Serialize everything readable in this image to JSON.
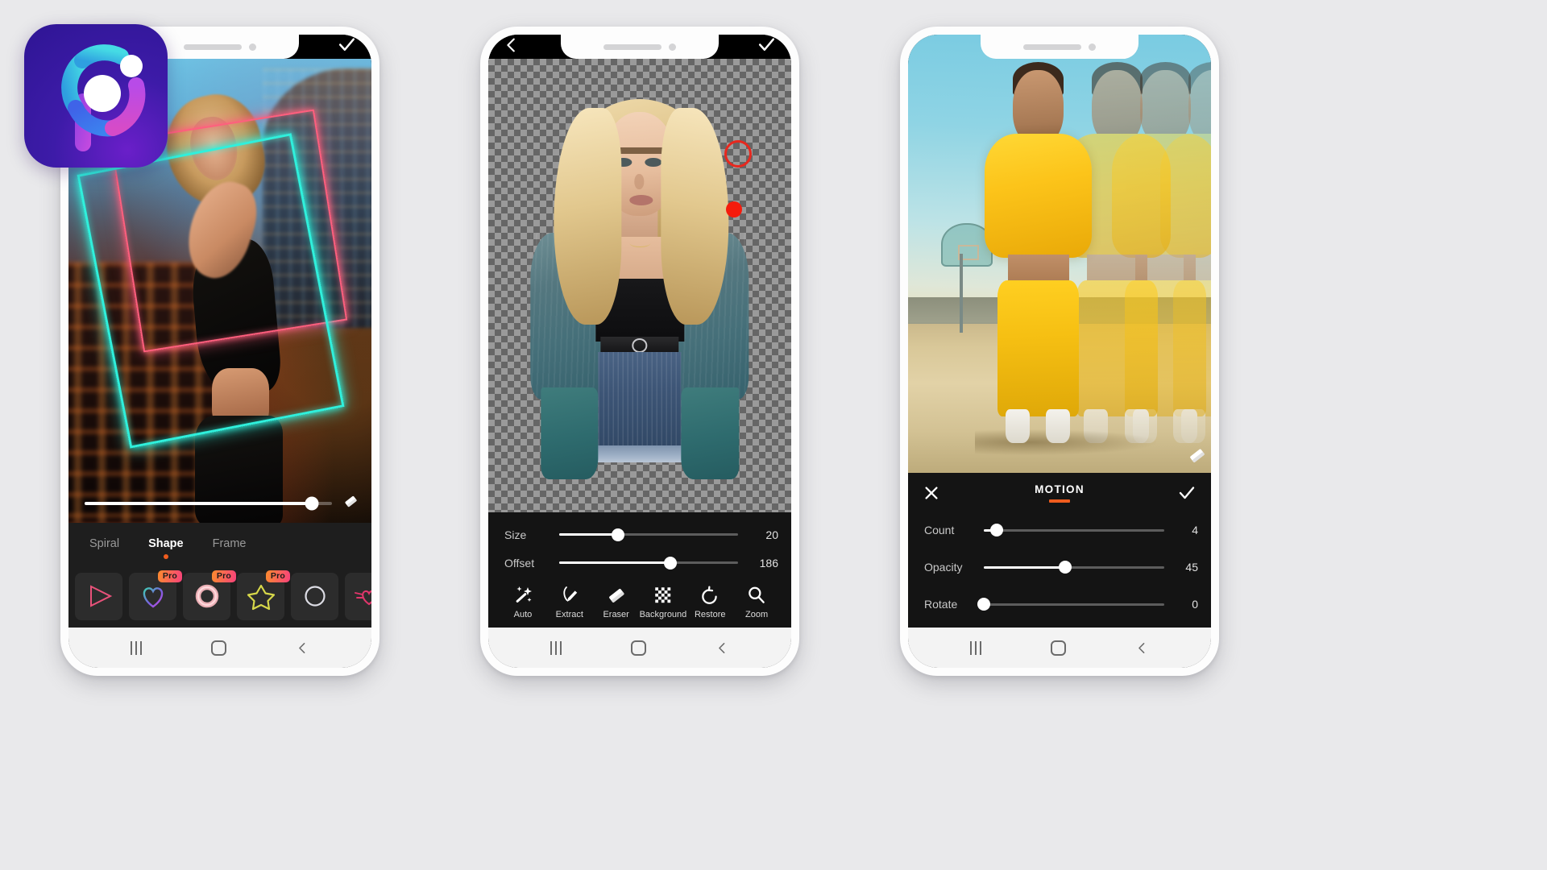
{
  "background_color": "#e9e9eb",
  "app_icon": {
    "name": "picsart-app-icon",
    "colors": {
      "bg_start": "#6a1fc9",
      "bg_end": "#2e1594",
      "cyan": "#3ecfe0",
      "blue": "#3f63e8",
      "magenta": "#c44be0",
      "white": "#ffffff"
    }
  },
  "phones": [
    {
      "id": "phone-1",
      "name": "neon-shape-editor",
      "header": {
        "confirm_icon": "check-icon"
      },
      "photo": {
        "description": "Woman in black crop top dancing at night in front of a lit skyscraper with neon rectangle frame overlay",
        "neon_colors": {
          "cyan": "#2ff0dc",
          "pink": "#ff5f7e"
        }
      },
      "intensity_slider": {
        "name": "intensity-slider",
        "value": 92,
        "trailing_icon": "eraser-icon"
      },
      "tabs": [
        {
          "label": "Spiral",
          "active": false
        },
        {
          "label": "Shape",
          "active": true
        },
        {
          "label": "Frame",
          "active": false
        }
      ],
      "active_tab_dot_color": "#ef5c1e",
      "shapes": [
        {
          "name": "triangle",
          "pro": false,
          "color": "#e8527a"
        },
        {
          "name": "heart",
          "pro": true,
          "color": "#3ecfb4"
        },
        {
          "name": "ring",
          "pro": true,
          "color": "#f6b6bd"
        },
        {
          "name": "star",
          "pro": true,
          "color": "#d7d84a"
        },
        {
          "name": "circle",
          "pro": false,
          "color": "#dcdce4"
        },
        {
          "name": "winged-heart",
          "pro": true,
          "color": "#e0366b"
        }
      ],
      "pro_badge_label": "Pro",
      "navbar": {
        "recents": "recents-icon",
        "home": "home-icon",
        "back": "back-icon"
      }
    },
    {
      "id": "phone-2",
      "name": "cutout-background-remover",
      "header": {
        "back_icon": "back-arrow-icon",
        "confirm_icon": "check-icon"
      },
      "photo": {
        "description": "Blonde woman in denim jacket and black top cut out on transparent checkerboard background"
      },
      "brush_cursor": {
        "ring_color": "#e8281e",
        "dot_color": "#f51b0c"
      },
      "sliders": [
        {
          "label": "Size",
          "value": 20,
          "percent": 33
        },
        {
          "label": "Offset",
          "value": 186,
          "percent": 62
        }
      ],
      "tools": [
        {
          "label": "Auto",
          "icon": "magic-wand-icon"
        },
        {
          "label": "Extract",
          "icon": "lasso-pen-icon"
        },
        {
          "label": "Eraser",
          "icon": "eraser-icon"
        },
        {
          "label": "Background",
          "icon": "checkerboard-icon"
        },
        {
          "label": "Restore",
          "icon": "undo-arrow-icon"
        },
        {
          "label": "Zoom",
          "icon": "magnifier-icon"
        }
      ],
      "navbar": {
        "recents": "recents-icon",
        "home": "home-icon",
        "back": "back-icon"
      }
    },
    {
      "id": "phone-3",
      "name": "motion-effect-editor",
      "photo": {
        "description": "Woman in yellow hoodie and sweatpants on a basketball court with repeated motion echo copies"
      },
      "eraser_badge_icon": "eraser-icon",
      "panel": {
        "title": "MOTION",
        "title_underline_color": "#ef5c1e",
        "close_icon": "close-x-icon",
        "confirm_icon": "check-icon",
        "sliders": [
          {
            "label": "Count",
            "value": 4,
            "percent": 7
          },
          {
            "label": "Opacity",
            "value": 45,
            "percent": 45
          },
          {
            "label": "Rotate",
            "value": 0,
            "percent": 0
          }
        ]
      },
      "navbar": {
        "recents": "recents-icon",
        "home": "home-icon",
        "back": "back-icon"
      }
    }
  ]
}
